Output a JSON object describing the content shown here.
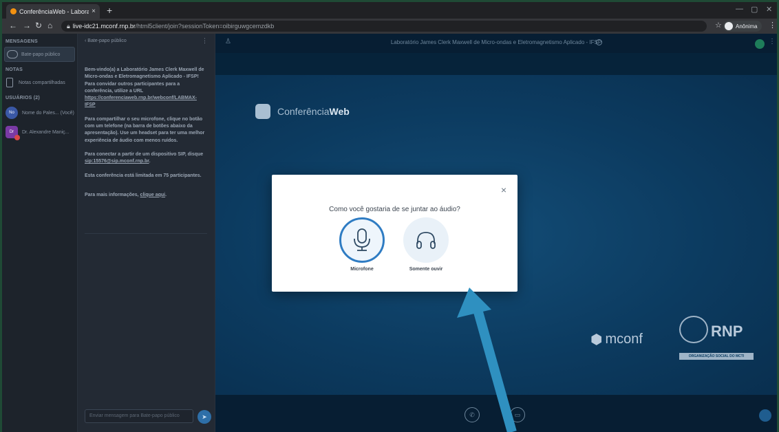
{
  "browser": {
    "tab_title": "ConferênciaWeb - Laboratório Ja",
    "tab_close": "×",
    "new_tab": "+",
    "url_host": "live-idc21.mconf.rnp.br",
    "url_path": "/html5client/join?sessionToken=oibirguwgcemzdkb",
    "profile_label": "Anônima"
  },
  "sidebar": {
    "messages_header": "MENSAGENS",
    "public_chat": "Bate-papo público",
    "notes_header": "NOTAS",
    "shared_notes": "Notas compartilhadas",
    "users_header": "USUÁRIOS (2)",
    "users": [
      {
        "initials": "No",
        "name": "Nome do Pales... (Você)"
      },
      {
        "initials": "Dr",
        "name": "Dr. Alexandre Maniç..."
      }
    ]
  },
  "chat": {
    "back_title": "‹  Bate-papo público",
    "welcome_1": "Bem-vindo(a) a Laboratório James Clerk Maxwell de Micro-ondas e Eletromagnetismo Aplicado - IFSP! Para convidar outros participantes para a conferência, utilize a URL ",
    "welcome_link": "https://conferenciaweb.rnp.br/webconf/LABMAX-IFSP",
    "welcome_2": "Para compartilhar o seu microfone, clique no botão com um telefone (na barra de botões abaixo da apresentação). Use um headset para ter uma melhor experiência de áudio com menos ruídos.",
    "welcome_3a": "Para conectar a partir de um dispositivo SIP, disque ",
    "welcome_3_link": "sip:15576@sip.mconf.rnp.br",
    "welcome_4": "Esta conferência está limitada em 75 participantes.",
    "welcome_5a": "Para mais informações, ",
    "welcome_5_link": "clique aqui",
    "input_placeholder": "Enviar mensagem para Bate-papo público"
  },
  "main": {
    "session_title": "Laboratório James Clerk Maxwell de Micro-ondas e Eletromagnetismo Aplicado - IFSP",
    "slide_logo_prefix": "Conferência",
    "slide_logo_bold": "Web",
    "mconf_logo": "mconf",
    "rnp_logo": "RNP",
    "rnp_sub": "ORGANIZAÇÃO SOCIAL DO MCTI"
  },
  "modal": {
    "question": "Como você gostaria de se juntar ao áudio?",
    "mic_label": "Microfone",
    "listen_label": "Somente ouvir",
    "close": "×"
  },
  "colors": {
    "accent": "#2f7cc3",
    "arrow": "#2f90c0"
  }
}
